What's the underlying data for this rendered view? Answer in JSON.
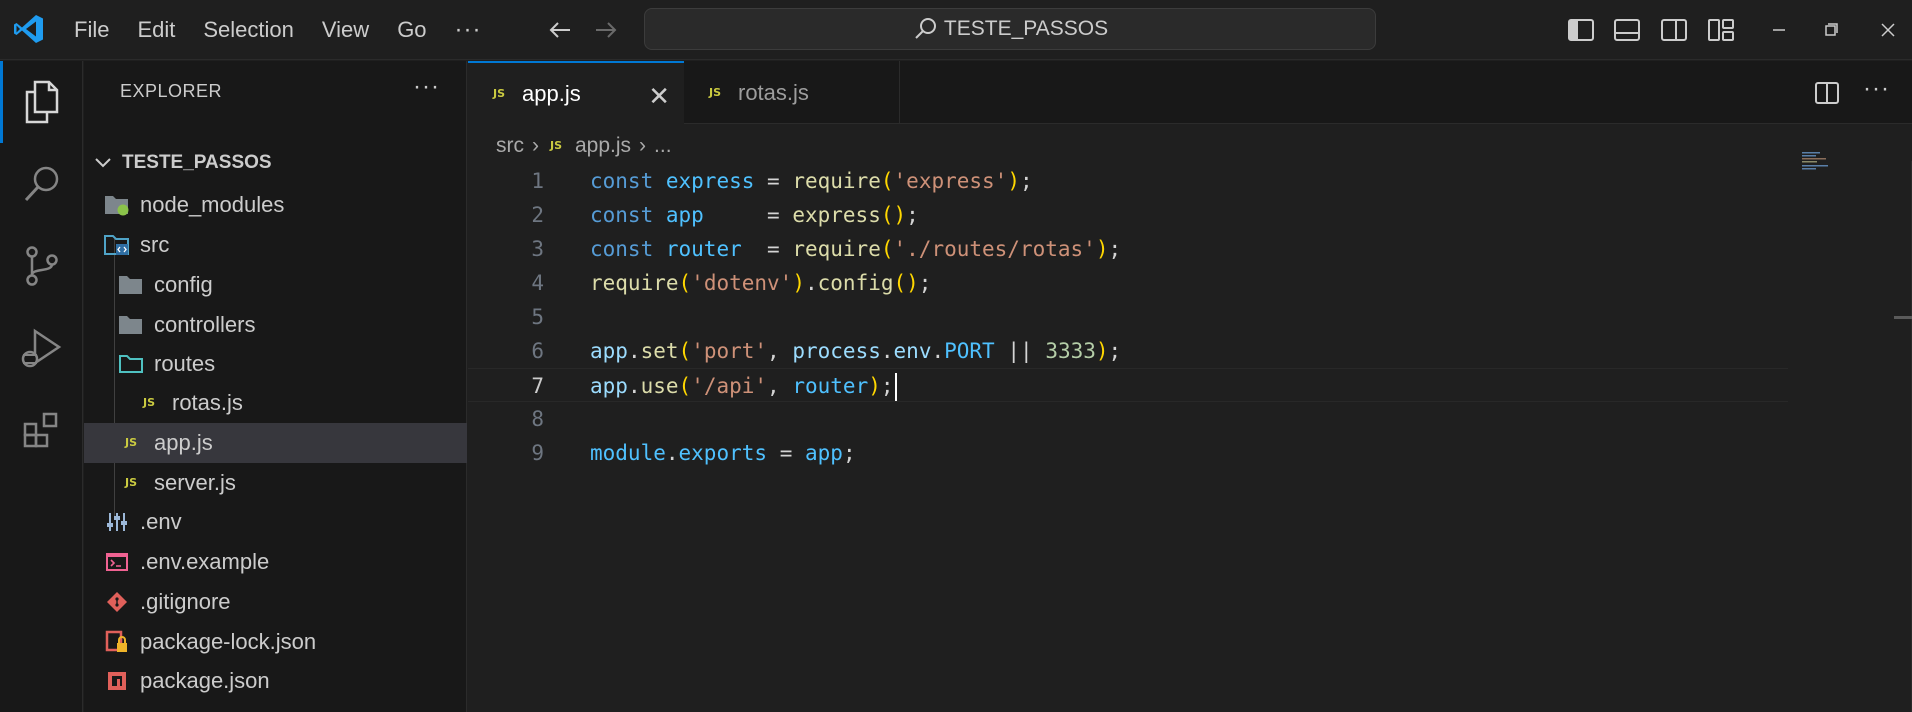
{
  "menu": [
    "File",
    "Edit",
    "Selection",
    "View",
    "Go"
  ],
  "menu_more": "···",
  "search": {
    "text": "TESTE_PASSOS"
  },
  "explorer": {
    "title": "EXPLORER",
    "more": "···",
    "project": "TESTE_PASSOS",
    "items": [
      {
        "label": "node_modules",
        "icon": "folder-node-icon"
      },
      {
        "label": "src",
        "icon": "folder-src-icon"
      },
      {
        "label": "config",
        "icon": "folder-icon"
      },
      {
        "label": "controllers",
        "icon": "folder-icon"
      },
      {
        "label": "routes",
        "icon": "folder-open-icon"
      },
      {
        "label": "rotas.js",
        "icon": "js-file-icon"
      },
      {
        "label": "app.js",
        "icon": "js-file-icon",
        "selected": true
      },
      {
        "label": "server.js",
        "icon": "js-file-icon"
      },
      {
        "label": ".env",
        "icon": "env-file-icon"
      },
      {
        "label": ".env.example",
        "icon": "console-file-icon"
      },
      {
        "label": ".gitignore",
        "icon": "git-file-icon"
      },
      {
        "label": "package-lock.json",
        "icon": "lock-file-icon"
      },
      {
        "label": "package.json",
        "icon": "npm-file-icon"
      }
    ]
  },
  "tabs": [
    {
      "label": "app.js",
      "badge": "JS",
      "active": true
    },
    {
      "label": "rotas.js",
      "badge": "JS",
      "active": false
    }
  ],
  "breadcrumb": {
    "folder": "src",
    "file": "app.js",
    "more": "..."
  },
  "code": {
    "current_line": 7,
    "line_numbers": [
      "1",
      "2",
      "3",
      "4",
      "5",
      "6",
      "7",
      "8",
      "9"
    ],
    "lines": [
      "const express = require('express');",
      "const app     = express();",
      "const router  = require('./routes/rotas');",
      "require('dotenv').config();",
      "",
      "app.set('port', process.env.PORT || 3333);",
      "app.use('/api', router);",
      "",
      "module.exports = app;"
    ]
  },
  "colors": {
    "accent": "#0078d4",
    "keyword": "#569cd6",
    "variable": "#9cdcfe",
    "function": "#dcdcaa",
    "string": "#ce9178",
    "number": "#b5cea8",
    "bracket": "#ffd700"
  }
}
